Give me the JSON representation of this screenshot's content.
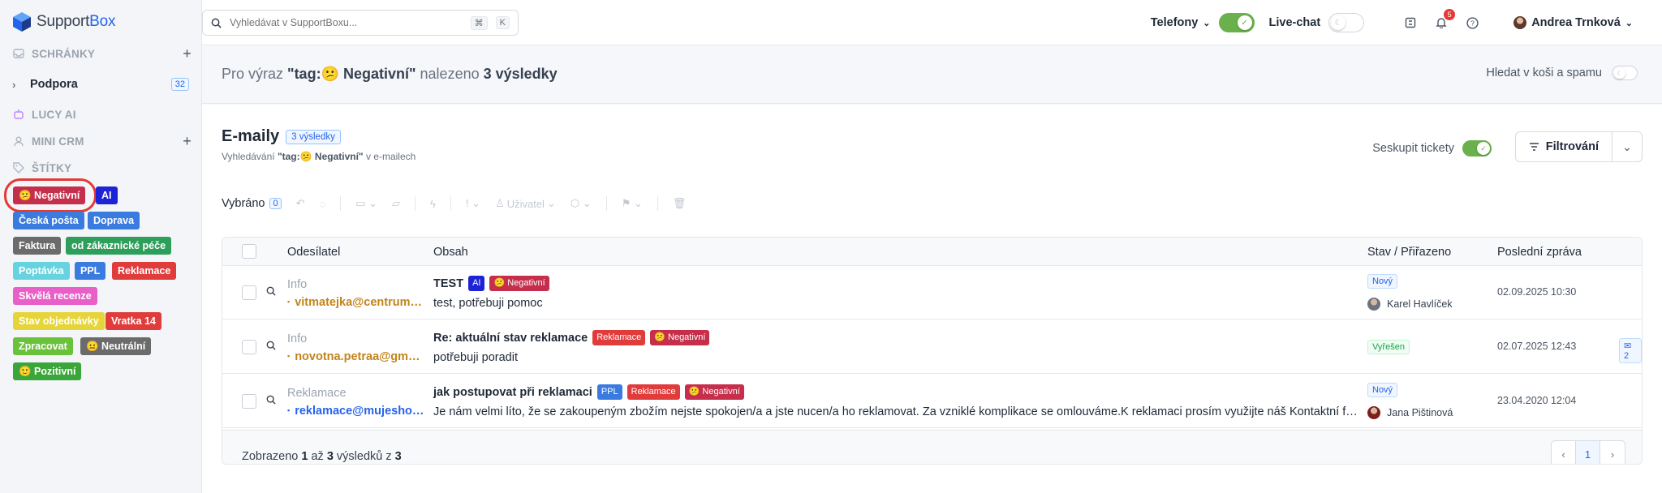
{
  "app": {
    "logo_prefix": "Support",
    "logo_suffix": "Box"
  },
  "sidebar": {
    "mailboxes_label": "SCHRÁNKY",
    "support_label": "Podpora",
    "support_count": "32",
    "lucy_label": "LUCY AI",
    "crm_label": "MINI CRM",
    "tags_label": "ŠTÍTKY",
    "tags": [
      {
        "label": "😕 Negativní",
        "color": "#c62f4b"
      },
      {
        "label": "AI",
        "color": "#1d24d6"
      },
      {
        "label": "Česká pošta",
        "color": "#3a7be0"
      },
      {
        "label": "Doprava",
        "color": "#3a7be0"
      },
      {
        "label": "Faktura",
        "color": "#6b6b6b"
      },
      {
        "label": "od zákaznické péče",
        "color": "#2e9e5b"
      },
      {
        "label": "Poptávka",
        "color": "#67d3e0"
      },
      {
        "label": "PPL",
        "color": "#3a7be0"
      },
      {
        "label": "Reklamace",
        "color": "#e03c3c"
      },
      {
        "label": "Skvělá recenze",
        "color": "#e85fc7"
      },
      {
        "label": "Stav objednávky",
        "color": "#e6d53a"
      },
      {
        "label": "Vratka 14",
        "color": "#e03c3c"
      },
      {
        "label": "Zpracovat",
        "color": "#6ac23a"
      },
      {
        "label": "😐 Neutrální",
        "color": "#6b6b6b"
      },
      {
        "label": "🙂 Pozitivní",
        "color": "#3aa63a"
      }
    ]
  },
  "topbar": {
    "search_placeholder": "Vyhledávat v SupportBoxu...",
    "kbd1": "⌘",
    "kbd2": "K",
    "phones_label": "Telefony",
    "livechat_label": "Live-chat",
    "notifications": "5",
    "user_name": "Andrea Trnková"
  },
  "results": {
    "prefix": "Pro výraz ",
    "query": "\"tag:😕 Negativní\"",
    "middle": " nalezeno ",
    "count": "3 výsledky",
    "trash_label": "Hledat v koši a spamu"
  },
  "panel": {
    "title": "E-maily",
    "count_badge": "3 výsledky",
    "sub_prefix": "Vyhledávání ",
    "sub_query": "\"tag:😕 Negativní\"",
    "sub_suffix": " v e-mailech",
    "group_label": "Seskupit tickety",
    "filter_label": "Filtrování"
  },
  "toolbar": {
    "selected_label": "Vybráno",
    "selected_count": "0",
    "user_label": "Uživatel"
  },
  "table": {
    "headers": {
      "sender": "Odesílatel",
      "content": "Obsah",
      "status": "Stav / Přiřazeno",
      "last": "Poslední zpráva"
    },
    "rows": [
      {
        "kind": "Info",
        "sender": "vitmatejka@centrum.cz",
        "subject": "TEST",
        "body": "test, potřebuji pomoc",
        "tags": [
          {
            "label": "AI",
            "color": "#1d24d6"
          },
          {
            "label": "😕 Negativní",
            "color": "#c62f4b"
          }
        ],
        "status": "Nový",
        "assignee": "Karel Havlíček",
        "date": "02.09.2025 10:30"
      },
      {
        "kind": "Info",
        "sender": "novotna.petraa@gmail.com",
        "subject": "Re: aktuální stav reklamace",
        "body": "potřebuji poradit",
        "tags": [
          {
            "label": "Reklamace",
            "color": "#e03c3c"
          },
          {
            "label": "😕 Negativní",
            "color": "#c62f4b"
          }
        ],
        "status": "Vyřešen",
        "assignee": "",
        "date": "02.07.2025 12:43",
        "messages": "2"
      },
      {
        "kind": "Reklamace",
        "sender": "reklamace@mujeshop.cz",
        "subject": "jak postupovat při reklamaci",
        "body": "Je nám velmi líto, že se zakoupeným zbožím nejste spokojen/a a jste nucen/a ho reklamovat. Za vzniklé komplikace se omlouváme.K reklamaci prosím využijte náš Kontaktní formulář",
        "tags": [
          {
            "label": "PPL",
            "color": "#3a7be0"
          },
          {
            "label": "Reklamace",
            "color": "#e03c3c"
          },
          {
            "label": "😕 Negativní",
            "color": "#c62f4b"
          }
        ],
        "status": "Nový",
        "assignee": "Jana Pištinová",
        "date": "23.04.2020 12:04"
      }
    ],
    "footer": {
      "prefix": "Zobrazeno ",
      "from": "1",
      "mid": " až ",
      "to": "3",
      "mid2": " výsledků z ",
      "total": "3"
    },
    "current_page": "1"
  }
}
